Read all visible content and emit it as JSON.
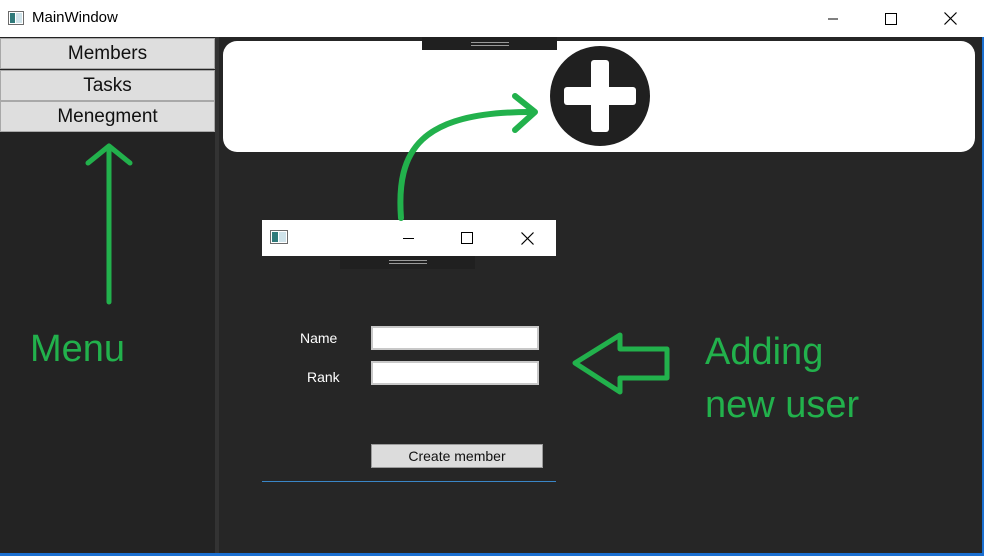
{
  "window": {
    "title": "MainWindow"
  },
  "sidebar": {
    "items": [
      {
        "label": "Members"
      },
      {
        "label": "Tasks"
      },
      {
        "label": "Menegment"
      }
    ]
  },
  "dialog": {
    "fields": [
      {
        "label": "Name",
        "value": ""
      },
      {
        "label": "Rank",
        "value": ""
      }
    ],
    "create_button_label": "Create member"
  },
  "annotations": {
    "menu": "Menu",
    "adding_line1": "Adding",
    "adding_line2": "new user"
  },
  "icons": {
    "app": "app-window-icon",
    "add": "plus-circle-icon",
    "minimize": "minimize-icon",
    "maximize": "maximize-icon",
    "close": "close-icon"
  },
  "colors": {
    "background": "#262626",
    "annotation_green": "#22b14c",
    "accent_border": "#1a6fd1"
  }
}
